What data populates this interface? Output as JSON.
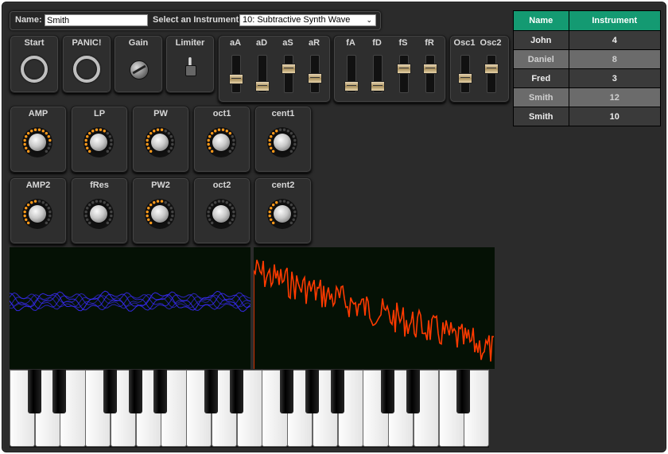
{
  "topbar": {
    "name_label": "Name:",
    "name_value": "Smith",
    "instrument_label": "Select an Instrument:",
    "instrument_selected": "10: Subtractive Synth Wave"
  },
  "controls": {
    "start_label": "Start",
    "panic_label": "PANIC!",
    "gain_label": "Gain",
    "limiter_label": "Limiter"
  },
  "amp_envelope": {
    "labels": [
      "aA",
      "aD",
      "aS",
      "aR"
    ],
    "levels": [
      0.35,
      0.1,
      0.75,
      0.4
    ]
  },
  "filter_envelope": {
    "labels": [
      "fA",
      "fD",
      "fS",
      "fR"
    ],
    "levels": [
      0.1,
      0.1,
      0.75,
      0.75
    ]
  },
  "oscillators": {
    "labels": [
      "Osc1",
      "Osc2"
    ],
    "levels": [
      0.4,
      0.75
    ]
  },
  "knobs_row1": [
    "AMP",
    "LP",
    "PW",
    "oct1",
    "cent1"
  ],
  "knobs_row1_levels": [
    0.85,
    0.65,
    0.55,
    0.7,
    0.45
  ],
  "knobs_row2": [
    "AMP2",
    "fRes",
    "PW2",
    "oct2",
    "cent2"
  ],
  "knobs_row2_levels": [
    0.5,
    0.0,
    0.55,
    0.0,
    0.45
  ],
  "players": {
    "headers": [
      "Name",
      "Instrument"
    ],
    "rows": [
      {
        "name": "John",
        "instrument": "4"
      },
      {
        "name": "Daniel",
        "instrument": "8"
      },
      {
        "name": "Fred",
        "instrument": "3"
      },
      {
        "name": "Smith",
        "instrument": "12"
      },
      {
        "name": "Smith",
        "instrument": "10"
      }
    ]
  },
  "colors": {
    "table_header": "#149a72",
    "waveform": "#3a2bff",
    "spectrum": "#ff3a00",
    "knob_led": "#ff9a1a"
  }
}
